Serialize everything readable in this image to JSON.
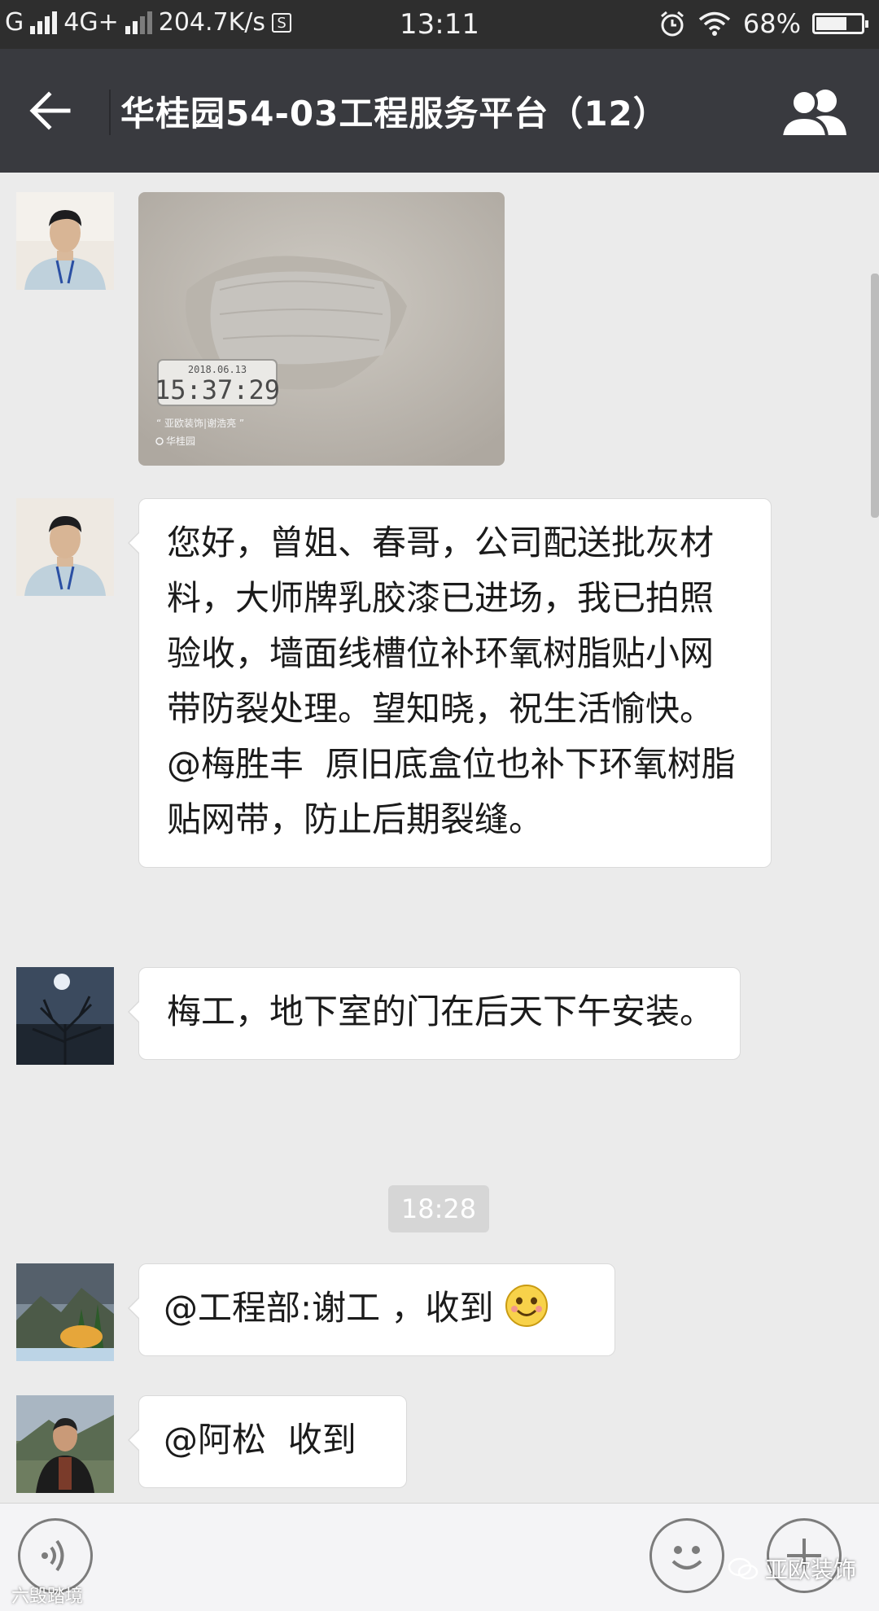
{
  "status_bar": {
    "carrier_g": "G",
    "network": "4G+",
    "speed": "204.7K/s",
    "s_icon": "S",
    "time": "13:11",
    "battery": "68%",
    "battery_level": 0.68
  },
  "header": {
    "title": "华桂园54-03工程服务平台（12）",
    "back_icon": "back-arrow-icon",
    "members_icon": "group-members-icon"
  },
  "messages": [
    {
      "type": "image",
      "sender_avatar": "avatar-man-id-badge",
      "photo_date": "2018.06.13",
      "photo_time": "15:37:29",
      "photo_caption": "“ 亚欧装饰|谢浩亮 ”",
      "photo_location": "华桂园"
    },
    {
      "type": "text",
      "sender_avatar": "avatar-man-id-badge",
      "text": "您好，曾姐、春哥，公司配送批灰材料，大师牌乳胶漆已进场，我已拍照验收，墙面线槽位补环氧树脂贴小网带防裂处理。望知晓，祝生活愉快。@梅胜丰  原旧底盒位也补下环氧树脂贴网带，防止后期裂缝。"
    },
    {
      "type": "text",
      "sender_avatar": "avatar-night-tree",
      "text": "梅工，地下室的门在后天下午安装。"
    },
    {
      "type": "time",
      "text": "18:28"
    },
    {
      "type": "text",
      "sender_avatar": "avatar-landscape",
      "text": "@工程部:谢工 ，收到",
      "emoji": "smile-emoji"
    },
    {
      "type": "text",
      "sender_avatar": "avatar-man-outdoor",
      "text": "@阿松  收到"
    }
  ],
  "input_bar": {
    "voice_icon": "voice-icon",
    "emoji_icon": "emoji-icon",
    "plus_icon": "plus-icon"
  },
  "watermarks": {
    "left": "六毁踏境",
    "right": "亚欧装饰"
  }
}
